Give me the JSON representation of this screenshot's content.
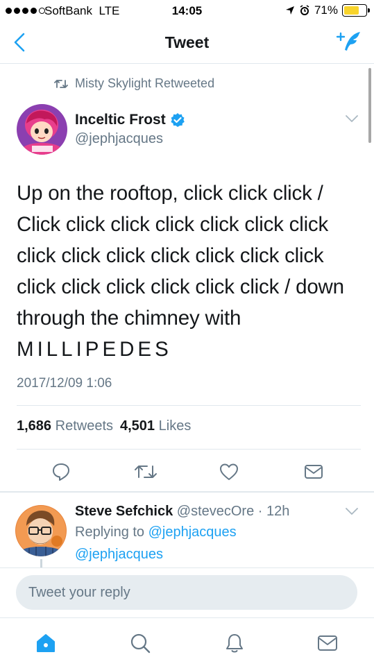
{
  "status_bar": {
    "carrier": "SoftBank",
    "network": "LTE",
    "time": "14:05",
    "battery": "71%",
    "battery_level": 0.71
  },
  "nav": {
    "title": "Tweet",
    "back_icon": "chevron-left-icon",
    "compose_icon": "compose-tweet-icon"
  },
  "tweet": {
    "retweeted_by": "Misty Skylight Retweeted",
    "author_name": "Inceltic Frost",
    "author_handle": "@jephjacques",
    "verified": true,
    "text_main": "Up on the rooftop, click click click /\nClick click click click click click click\nclick click click click click click click\nclick click click click click click / down\nthrough the chimney with\n",
    "text_spaced": "MILLIPEDES",
    "timestamp": "2017/12/09 1:06",
    "retweet_count": "1,686",
    "retweets_label": "Retweets",
    "like_count": "4,501",
    "likes_label": "Likes"
  },
  "reply": {
    "author_name": "Steve Sefchick",
    "author_handle": "@stevecOre",
    "separator": " · ",
    "age": "12h",
    "replying_label": "Replying to ",
    "replying_to": "@jephjacques",
    "text": "@jephjacques"
  },
  "reply_bar": {
    "placeholder": "Tweet your reply"
  },
  "colors": {
    "accent": "#1da1f2",
    "secondary_text": "#657786",
    "divider": "#e1e8ed",
    "battery": "#f8d42b"
  },
  "tabs": [
    {
      "name": "home-icon",
      "active": true
    },
    {
      "name": "search-icon",
      "active": false
    },
    {
      "name": "notifications-icon",
      "active": false
    },
    {
      "name": "messages-icon",
      "active": false
    }
  ]
}
